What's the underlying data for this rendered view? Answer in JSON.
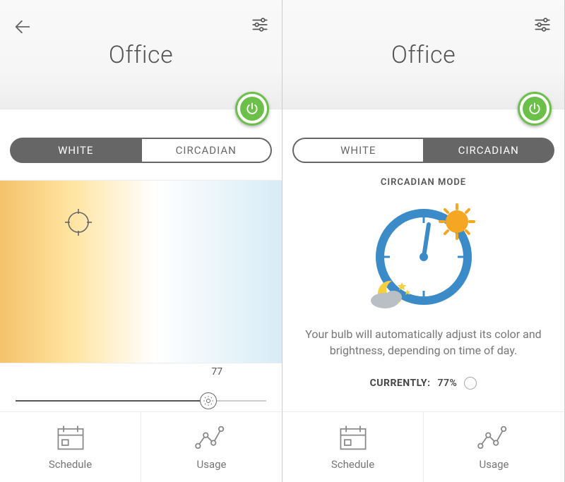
{
  "left": {
    "room_title": "Office",
    "tabs": {
      "white": "WHITE",
      "circadian": "CIRCADIAN",
      "active": "white"
    },
    "brightness": {
      "value": 77,
      "label": "77"
    },
    "nav": {
      "schedule": "Schedule",
      "usage": "Usage"
    }
  },
  "right": {
    "room_title": "Office",
    "tabs": {
      "white": "WHITE",
      "circadian": "CIRCADIAN",
      "active": "circadian"
    },
    "circadian": {
      "heading": "CIRCADIAN MODE",
      "description": "Your bulb will automatically adjust its color and brightness, depending on time of day.",
      "currently_label": "CURRENTLY:",
      "currently_value": "77%"
    },
    "nav": {
      "schedule": "Schedule",
      "usage": "Usage"
    }
  },
  "colors": {
    "accent_green": "#6cc04a",
    "clock_blue": "#3b8bc9",
    "sun_orange": "#f5a623",
    "moon_yellow": "#f6cf3f",
    "cloud_gray": "#b9bfc4"
  }
}
